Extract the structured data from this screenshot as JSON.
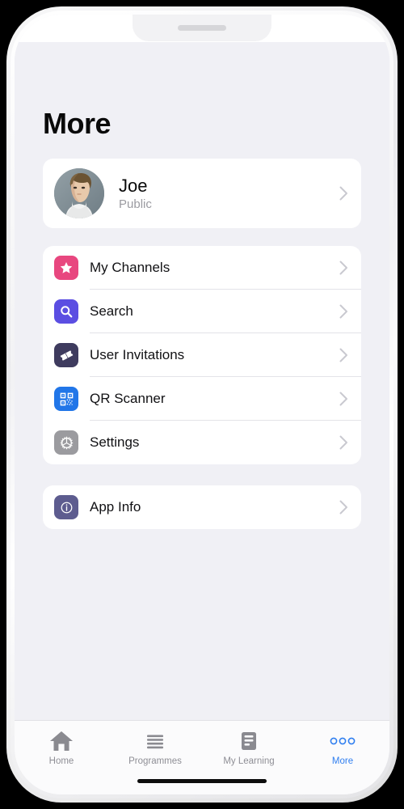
{
  "device": {
    "frame": "iphone-white",
    "notch_icon": "speaker-grille",
    "home_indicator": "home-indicator-bar"
  },
  "header": {
    "title": "More"
  },
  "profile": {
    "name": "Joe",
    "subtitle": "Public",
    "avatar_icon": "user-photo-avatar",
    "chevron_icon": "chevron-right-icon"
  },
  "menu_cards": [
    {
      "items": [
        {
          "label": "My Channels",
          "icon": "star-icon",
          "color": "#e8477f"
        },
        {
          "label": "Search",
          "icon": "search-icon",
          "color": "#5b4ee2"
        },
        {
          "label": "User Invitations",
          "icon": "ticket-icon",
          "color": "#3e3b5e"
        },
        {
          "label": "QR Scanner",
          "icon": "qr-code-icon",
          "color": "#2176e8"
        },
        {
          "label": "Settings",
          "icon": "gear-icon",
          "color": "#9b9b9f"
        }
      ]
    },
    {
      "items": [
        {
          "label": "App Info",
          "icon": "info-icon",
          "color": "#5d5c8f"
        }
      ]
    }
  ],
  "tab_bar": {
    "active_color": "#2f7ef0",
    "inactive_color": "#8e8e95",
    "tabs": [
      {
        "label": "Home",
        "icon": "home-icon",
        "active": false
      },
      {
        "label": "Programmes",
        "icon": "list-lines-icon",
        "active": false
      },
      {
        "label": "My Learning",
        "icon": "document-icon",
        "active": false
      },
      {
        "label": "More",
        "icon": "three-dots-icon",
        "active": true
      }
    ]
  }
}
